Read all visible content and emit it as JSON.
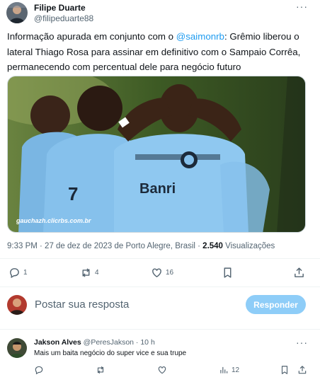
{
  "tweet": {
    "author_name": "Filipe Duarte",
    "author_handle": "@filipeduarte88",
    "more_label": "···",
    "text_before": "Informação apurada em conjunto com o ",
    "mention": "@saimonrb",
    "text_after": ": Grêmio liberou o lateral Thiago Rosa para assinar em definitivo com o Sampaio Corrêa, permanecendo com percentual dele para negócio futuro",
    "image_watermark": "gauchazh.clicrbs.com.br",
    "image_description": "Jogadores do Grêmio comemorando gol com as mãos em formato de coração",
    "timestamp": "9:33 PM · 27 de dez de 2023 de Porto Alegre, Brasil · ",
    "views_count": "2.540",
    "views_label": " Visualizações",
    "actions": {
      "replies": "1",
      "retweets": "4",
      "likes": "16"
    }
  },
  "composer": {
    "placeholder": "Postar sua resposta",
    "reply_button": "Responder"
  },
  "reply": {
    "author_name": "Jakson Alves",
    "author_meta": "@PeresJakson · 10 h",
    "text": "Mais um baita negócio do super vice e sua trupe",
    "actions": {
      "replies": "",
      "retweets": "",
      "likes": "",
      "views": "12"
    }
  },
  "colors": {
    "accent": "#1d9bf0",
    "secondary_text": "#536471",
    "reply_button_bg": "#8ecdf8"
  }
}
